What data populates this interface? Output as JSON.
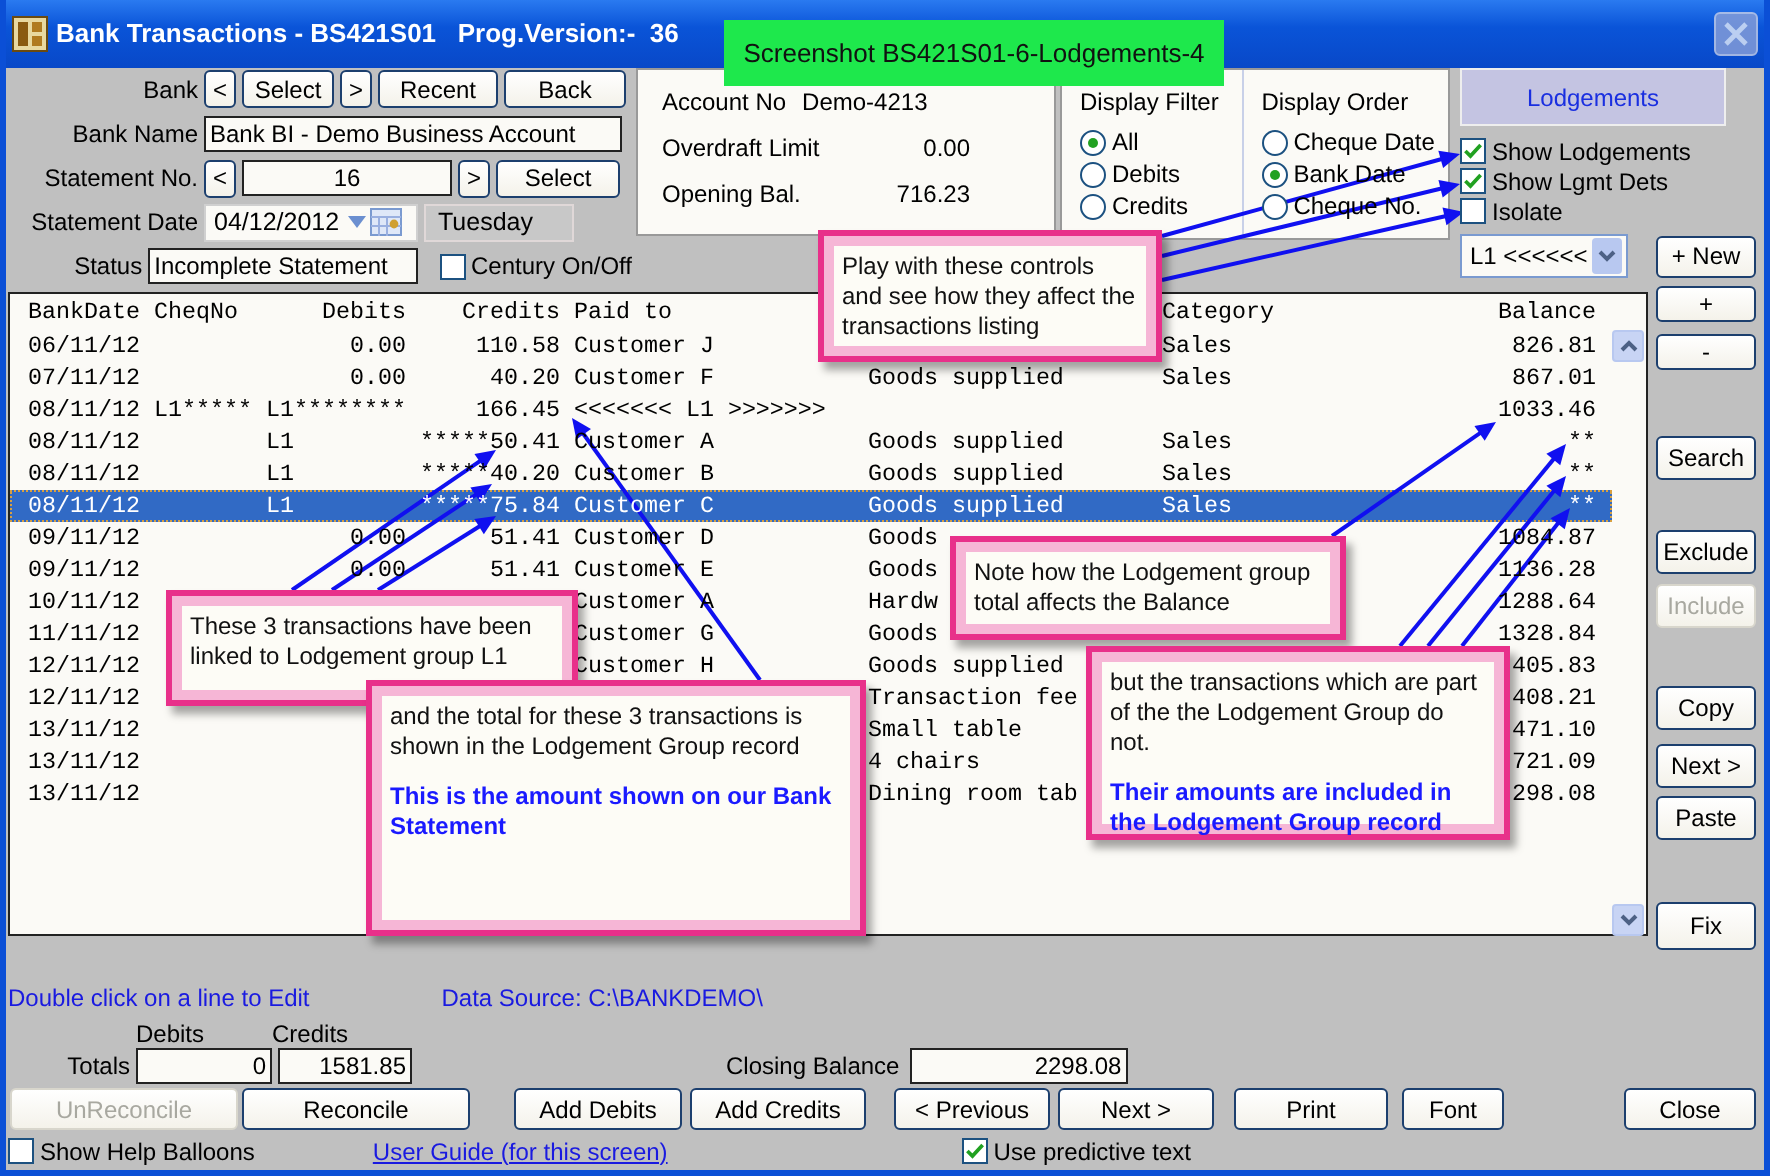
{
  "window": {
    "title": "Bank Transactions - BS421S01   Prog.Version:-  36"
  },
  "screenshot_label": "Screenshot BS421S01-6-Lodgements-4",
  "bank": {
    "label": "Bank",
    "buttons": [
      "<",
      "Select",
      ">",
      "Recent",
      "Back"
    ]
  },
  "bank_name": {
    "label": "Bank Name",
    "value": "Bank BI - Demo Business Account"
  },
  "statement_no": {
    "label": "Statement No.",
    "prev": "<",
    "value": "16",
    "next": ">",
    "select": "Select"
  },
  "statement_date": {
    "label": "Statement Date",
    "value": "04/12/2012",
    "day": "Tuesday"
  },
  "status": {
    "label": "Status",
    "value": "Incomplete Statement"
  },
  "century": {
    "label": "Century On/Off",
    "checked": false
  },
  "account": [
    {
      "label": "Account No",
      "value": "Demo-4213"
    },
    {
      "label": "Overdraft Limit",
      "value": "0.00"
    },
    {
      "label": "Opening Bal.",
      "value": "716.23"
    }
  ],
  "display_filter": {
    "title": "Display Filter",
    "options": [
      {
        "label": "All",
        "selected": true
      },
      {
        "label": "Debits",
        "selected": false
      },
      {
        "label": "Credits",
        "selected": false
      }
    ]
  },
  "display_order": {
    "title": "Display Order",
    "options": [
      {
        "label": "Cheque Date",
        "selected": false
      },
      {
        "label": "Bank Date",
        "selected": true
      },
      {
        "label": "Cheque No.",
        "selected": false
      }
    ]
  },
  "lodgements_panel": "Lodgements",
  "options": [
    {
      "label": "Show Lodgements",
      "checked": true
    },
    {
      "label": "Show Lgmt Dets",
      "checked": true
    },
    {
      "label": "Isolate",
      "checked": false
    }
  ],
  "lodgement_dropdown": "L1 <<<<<<",
  "new_button": "+ New",
  "side_buttons": [
    {
      "label": "+",
      "disabled": false
    },
    {
      "label": "-",
      "disabled": false
    },
    {
      "label": "Search",
      "disabled": false
    },
    {
      "label": "Exclude",
      "disabled": false
    },
    {
      "label": "Include",
      "disabled": true
    },
    {
      "label": "Copy",
      "disabled": false
    },
    {
      "label": "Next >",
      "disabled": false
    },
    {
      "label": "Paste",
      "disabled": false
    },
    {
      "label": "Fix",
      "disabled": false
    }
  ],
  "table": {
    "header": {
      "date": "BankDate",
      "cheq_no": "CheqNo",
      "debits": "Debits",
      "credits": "Credits",
      "paid_to": "Paid to",
      "category": "Category",
      "balance": "Balance"
    },
    "rows": [
      {
        "kind": "normal",
        "selected": false,
        "date": "06/11/12",
        "debits": "0.00",
        "credits": "110.58",
        "paid_to": "Customer J",
        "category": "Sales",
        "balance": "826.81"
      },
      {
        "kind": "normal",
        "selected": false,
        "date": "07/11/12",
        "debits": "0.00",
        "credits": "40.20",
        "paid_to": "Customer F",
        "column_6": "Goods supplied",
        "category": "Sales",
        "balance": "867.01"
      },
      {
        "kind": "group",
        "selected": false,
        "date": "08/11/12",
        "cheq_no": "L1*****",
        "debits": "L1********",
        "credits": "166.45",
        "paid_to": "<<<<<<< L1 >>>>>>>",
        "balance": "1033.46"
      },
      {
        "kind": "member",
        "selected": false,
        "date": "08/11/12",
        "debits": "L1",
        "credits": "*****50.41",
        "paid_to": "Customer A",
        "column_6": "Goods supplied",
        "category": "Sales",
        "balance": "**"
      },
      {
        "kind": "member",
        "selected": false,
        "date": "08/11/12",
        "debits": "L1",
        "credits": "*****40.20",
        "paid_to": "Customer B",
        "column_6": "Goods supplied",
        "category": "Sales",
        "balance": "**"
      },
      {
        "kind": "member",
        "selected": true,
        "date": "08/11/12",
        "debits": "L1",
        "credits": "*****75.84",
        "paid_to": "Customer C",
        "column_6": "Goods supplied",
        "category": "Sales",
        "balance": "**"
      },
      {
        "kind": "normal",
        "selected": false,
        "date": "09/11/12",
        "debits": "0.00",
        "credits": "51.41",
        "paid_to": "Customer D",
        "column_6": "Goods",
        "balance": "1084.87"
      },
      {
        "kind": "normal",
        "selected": false,
        "date": "09/11/12",
        "debits": "0.00",
        "credits": "51.41",
        "paid_to": "Customer E",
        "column_6": "Goods",
        "balance": "1136.28"
      },
      {
        "kind": "normal",
        "selected": false,
        "date": "10/11/12",
        "paid_to": "Customer A",
        "column_6": "Hardw",
        "balance": "1288.64"
      },
      {
        "kind": "normal",
        "selected": false,
        "date": "11/11/12",
        "paid_to": "Customer G",
        "column_6": "Goods",
        "balance": "1328.84"
      },
      {
        "kind": "normal",
        "selected": false,
        "date": "12/11/12",
        "paid_to": "Customer H",
        "column_6": "Goods supplied",
        "balance": "405.83"
      },
      {
        "kind": "normal",
        "selected": false,
        "date": "12/11/12",
        "column_6": "Transaction fee",
        "balance": "408.21"
      },
      {
        "kind": "normal",
        "selected": false,
        "date": "13/11/12",
        "column_6": "Small table",
        "balance": "471.10"
      },
      {
        "kind": "normal",
        "selected": false,
        "date": "13/11/12",
        "column_6": "4 chairs",
        "balance": "721.09"
      },
      {
        "kind": "normal",
        "selected": false,
        "date": "13/11/12",
        "column_6": "Dining room tab",
        "balance": "298.08"
      }
    ]
  },
  "callouts": [
    {
      "text": "Play with these controls and see how they affect the transactions listing"
    },
    {
      "text": "These 3 transactions have been linked to Lodgement group L1"
    },
    {
      "text": "and the total for these 3 transactions is shown in the Lodgement Group record",
      "note": "This is the amount shown on our Bank Statement"
    },
    {
      "text": "Note how the Lodgement group total affects the Balance"
    },
    {
      "text": "but the transactions which are part of the the Lodgement Group do not.",
      "note": "Their amounts are included in the Lodgement Group record"
    }
  ],
  "footer": {
    "hint": "Double click on a line to Edit",
    "data_source": "Data Source: C:\\BANKDEMO\\",
    "totals": {
      "label": "Totals",
      "debits_label": "Debits",
      "debits": "0",
      "credits_label": "Credits",
      "credits": "1581.85"
    },
    "closing": {
      "label": "Closing Balance",
      "value": "2298.08"
    },
    "buttons": [
      {
        "label": "UnReconcile",
        "disabled": true
      },
      {
        "label": "Reconcile",
        "disabled": false
      },
      {
        "label": "Add Debits",
        "disabled": false
      },
      {
        "label": "Add Credits",
        "disabled": false
      },
      {
        "label": "< Previous",
        "disabled": false
      },
      {
        "label": "Next >",
        "disabled": false
      },
      {
        "label": "Print",
        "disabled": false
      },
      {
        "label": "Font",
        "disabled": false
      },
      {
        "label": "Close",
        "disabled": false
      }
    ],
    "show_help": {
      "label": "Show Help Balloons",
      "checked": false
    },
    "user_guide": "User Guide (for this screen)",
    "predictive": {
      "label": "Use predictive text",
      "checked": true
    }
  }
}
